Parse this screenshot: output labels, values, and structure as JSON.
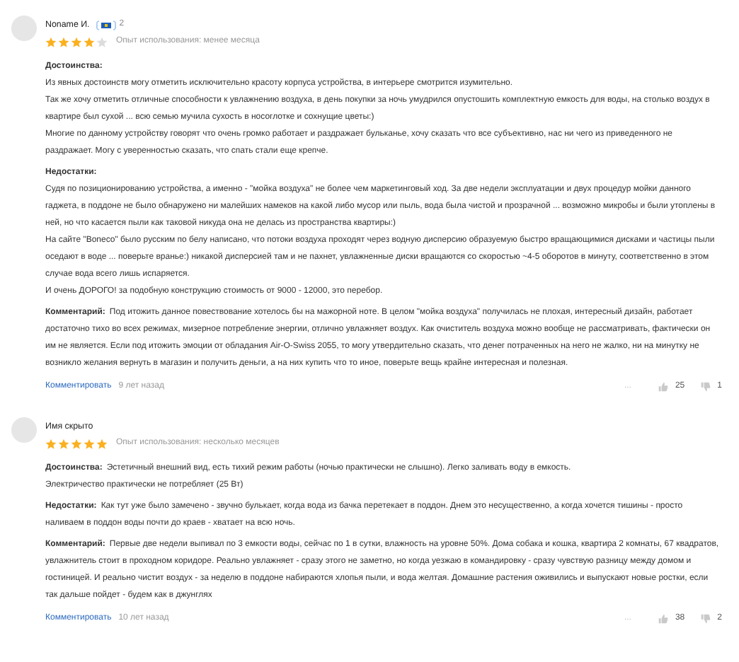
{
  "reviews": [
    {
      "author": "Noname И.",
      "badge_count": "2",
      "stars": 4,
      "experience": "Опыт использования: менее месяца",
      "sections": [
        {
          "label": "Достоинства:",
          "kind": "block",
          "paragraphs": [
            "Из явных достоинств могу отметить исключительно красоту корпуса устройства, в интерьере смотрится изумительно.",
            "Так же хочу отметить отличные способности к увлажнению воздуха, в день покупки за ночь умудрился опустошить комплектную емкость для воды, на столько воздух в квартире был сухой ... всю семью мучила сухость в носоглотке и сохнущие цветы:)",
            "Многие по данному устройству говорят что очень громко работает и раздражает бульканье, хочу сказать что все субъективно, нас ни чего из приведенного не раздражает. Могу с уверенностью сказать, что спать стали еще крепче."
          ]
        },
        {
          "label": "Недостатки:",
          "kind": "block",
          "paragraphs": [
            "Судя по позиционированию устройства, а именно - \"мойка воздуха\" не более чем маркетинговый ход. За две недели эксплуатации и двух процедур мойки данного гаджета, в поддоне не было обнаружено ни малейших намеков на какой либо мусор или пыль, вода была чистой и прозрачной ... возможно микробы и были утоплены в ней, но что касается пыли как таковой никуда она не делась из пространства квартиры:)",
            "На сайте \"Boneco\" было русским по белу написано, что потоки воздуха проходят через водную дисперсию образуемую быстро вращающимися дисками и частицы пыли оседают в воде ... поверьте вранье:) никакой дисперсией там и не пахнет, увлажненные диски вращаются со скоростью ~4-5 оборотов в минуту, соответственно в этом случае вода всего лишь испаряется.",
            "И очень ДОРОГО! за подобную конструкцию стоимость от 9000 - 12000, это перебор."
          ]
        },
        {
          "label": "Комментарий:",
          "kind": "inline",
          "paragraphs": [
            "Под итожить данное повествование хотелось бы на мажорной ноте. В целом \"мойка воздуха\" получилась не плохая, интересный дизайн, работает достаточно тихо во всех режимах, мизерное потребление энергии, отлично увлажняет воздух. Как очиститель воздуха можно вообще не рассматривать, фактически он им не является. Если под итожить эмоции от обладания Air-O-Swiss 2055, то могу утвердительно сказать, что денег потраченных на него не жалко, ни на минутку не возникло желания вернуть в магазин и получить деньги, а на них купить что то иное, поверьте вещь крайне интересная и полезная."
          ]
        }
      ],
      "comment_link": "Комментировать",
      "time": "9 лет назад",
      "more": "...",
      "likes": "25",
      "dislikes": "1"
    },
    {
      "author": "Имя скрыто",
      "stars": 5,
      "experience": "Опыт использования: несколько месяцев",
      "sections": [
        {
          "label": "Достоинства:",
          "kind": "inline",
          "paragraphs": [
            "Эстетичный внешний вид, есть тихий режим работы (ночью практически не слышно). Легко заливать воду в емкость.",
            "Электричество практически не потребляет (25 Вт)"
          ]
        },
        {
          "label": "Недостатки:",
          "kind": "inline",
          "paragraphs": [
            "Как тут уже было замечено - звучно булькает, когда вода из бачка перетекает в поддон. Днем это несущественно, а когда хочется тишины - просто наливаем в поддон воды почти до краев - хватает на всю ночь."
          ]
        },
        {
          "label": "Комментарий:",
          "kind": "inline",
          "paragraphs": [
            "Первые две недели выпивал по 3 емкости воды, сейчас по 1 в сутки, влажность на уровне 50%. Дома собака и кошка, квартира 2 комнаты, 67 квадратов, увлажнитель стоит в проходном коридоре. Реально увлажняет - сразу этого не заметно, но когда уезжаю в командировку - сразу чувствую разницу между домом и гостиницей. И реально чистит воздух - за неделю в поддоне набираются хлопья пыли, и вода желтая. Домашние растения оживились и выпускают новые ростки, если так дальше пойдет - будем как в джунглях"
          ]
        }
      ],
      "comment_link": "Комментировать",
      "time": "10 лет назад",
      "more": "...",
      "likes": "38",
      "dislikes": "2"
    }
  ]
}
